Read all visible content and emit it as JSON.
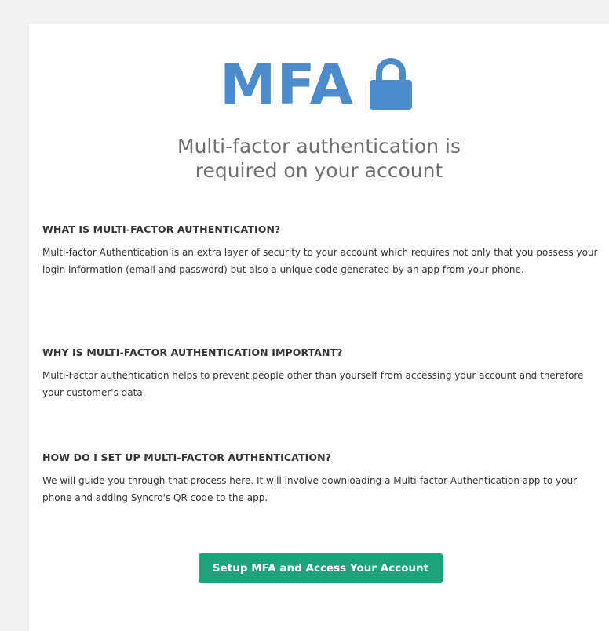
{
  "logo": {
    "text": "MFA",
    "icon": "lock-icon",
    "color": "#4d8ccc"
  },
  "headline": {
    "line1": "Multi-factor authentication is",
    "line2": "required on your account"
  },
  "sections": [
    {
      "heading": "WHAT IS MULTI-FACTOR AUTHENTICATION?",
      "body": "Multi-factor Authentication is an extra layer of security to your account which requires not only that you possess your login information (email and password) but also a unique code generated by an app from your phone."
    },
    {
      "heading": "WHY IS MULTI-FACTOR AUTHENTICATION IMPORTANT?",
      "body": "Multi-Factor authentication helps to prevent people other than yourself from accessing your account and therefore your customer's data."
    },
    {
      "heading": "HOW DO I SET UP MULTI-FACTOR AUTHENTICATION?",
      "body": "We will guide you through that process here. It will involve downloading a Multi-factor Authentication app to your phone and adding Syncro's QR code to the app."
    }
  ],
  "cta": {
    "label": "Setup MFA and Access Your Account",
    "color": "#1fa37a"
  }
}
